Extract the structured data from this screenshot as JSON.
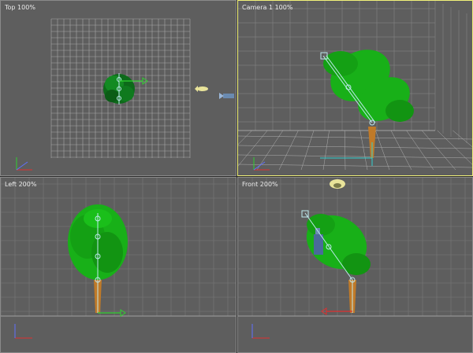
{
  "viewports": [
    {
      "id": "top",
      "label": "Top 100%"
    },
    {
      "id": "camera",
      "label": "Camera 1 100%"
    },
    {
      "id": "left",
      "label": "Left 200%"
    },
    {
      "id": "front",
      "label": "Front 200%"
    }
  ],
  "colors": {
    "viewport_bg": "#5e5e5e",
    "grid_line": "#7a7a7a",
    "grid_major": "#a0a0a0",
    "foliage": "#18b018",
    "foliage_dark": "#0d7a0d",
    "bone_line": "#bfe9ee",
    "trunk": "#c07a28",
    "active_border": "#f2f27a",
    "axis_x": "#e03030",
    "axis_y": "#30d030",
    "axis_z": "#3050e0"
  },
  "icons": {
    "axis_tripod": "xyz-axis-icon",
    "camera": "camera-icon",
    "light": "light-icon",
    "move_gizmo": "move-gizmo-icon"
  }
}
